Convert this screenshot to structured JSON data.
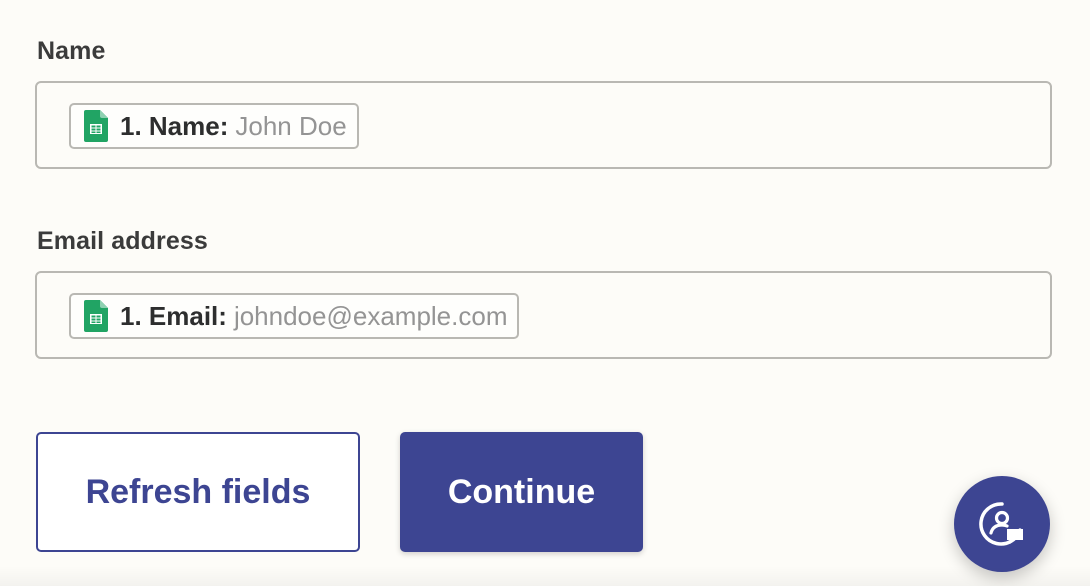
{
  "fields": [
    {
      "label": "Name",
      "token_key": "1. Name:",
      "token_value": "John Doe",
      "token_icon": "google-sheets-icon"
    },
    {
      "label": "Email address",
      "token_key": "1. Email:",
      "token_value": "johndoe@example.com",
      "token_icon": "google-sheets-icon"
    }
  ],
  "buttons": {
    "refresh_label": "Refresh fields",
    "continue_label": "Continue"
  },
  "support": {
    "icon": "support-chat-icon"
  },
  "colors": {
    "primary": "#3d4592",
    "sheets_green": "#21a464",
    "background": "#fdfcf8",
    "border": "#b9b8b3",
    "muted_text": "#949494"
  }
}
